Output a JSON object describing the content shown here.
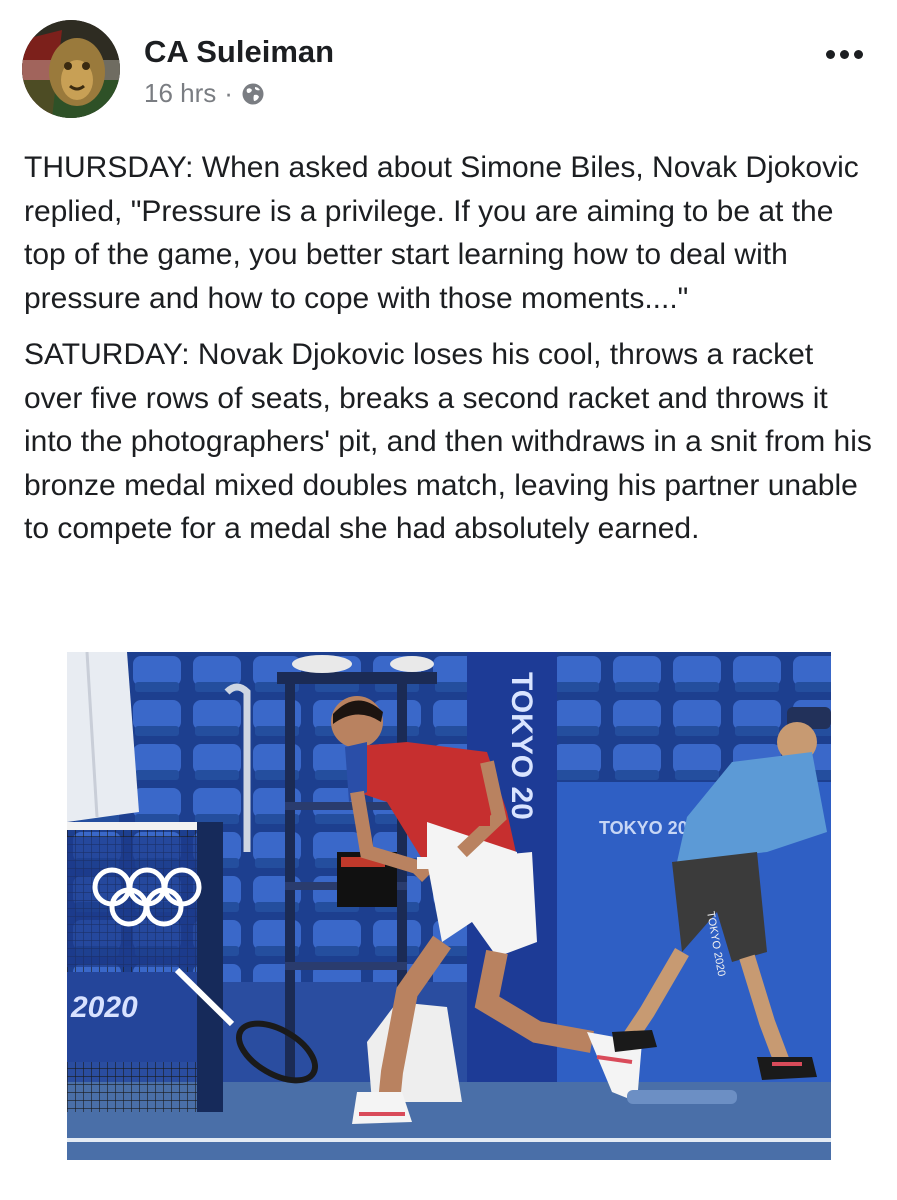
{
  "post": {
    "author": "CA Suleiman",
    "time": "16 hrs",
    "separator": "·",
    "privacy_icon": "globe-icon",
    "more_icon": "more-options-icon",
    "paragraphs": [
      "THURSDAY: When asked about Simone Biles, Novak Djokovic replied, \"Pressure is a privilege. If you are aiming to be at the top of the game, you better start learning how to deal with pressure and how to cope with those moments....\"",
      "SATURDAY: Novak Djokovic loses his cool, throws a racket over five rows of seats, breaks a second racket and throws it into the photographers' pit, and then withdraws in a snit from his bronze medal mixed doubles match, leaving his partner unable to compete for a medal she had absolutely earned."
    ],
    "photo": {
      "sign_text": "TOKYO 2020",
      "pillar_text": "TOKYO 20",
      "banner_text": "2020",
      "shorts_text": "TOKYO 2020"
    }
  },
  "colors": {
    "text": "#1c1e21",
    "meta": "#7a7d82",
    "seat_blue": "#2f5fc4",
    "court": "#4a6fa8"
  }
}
